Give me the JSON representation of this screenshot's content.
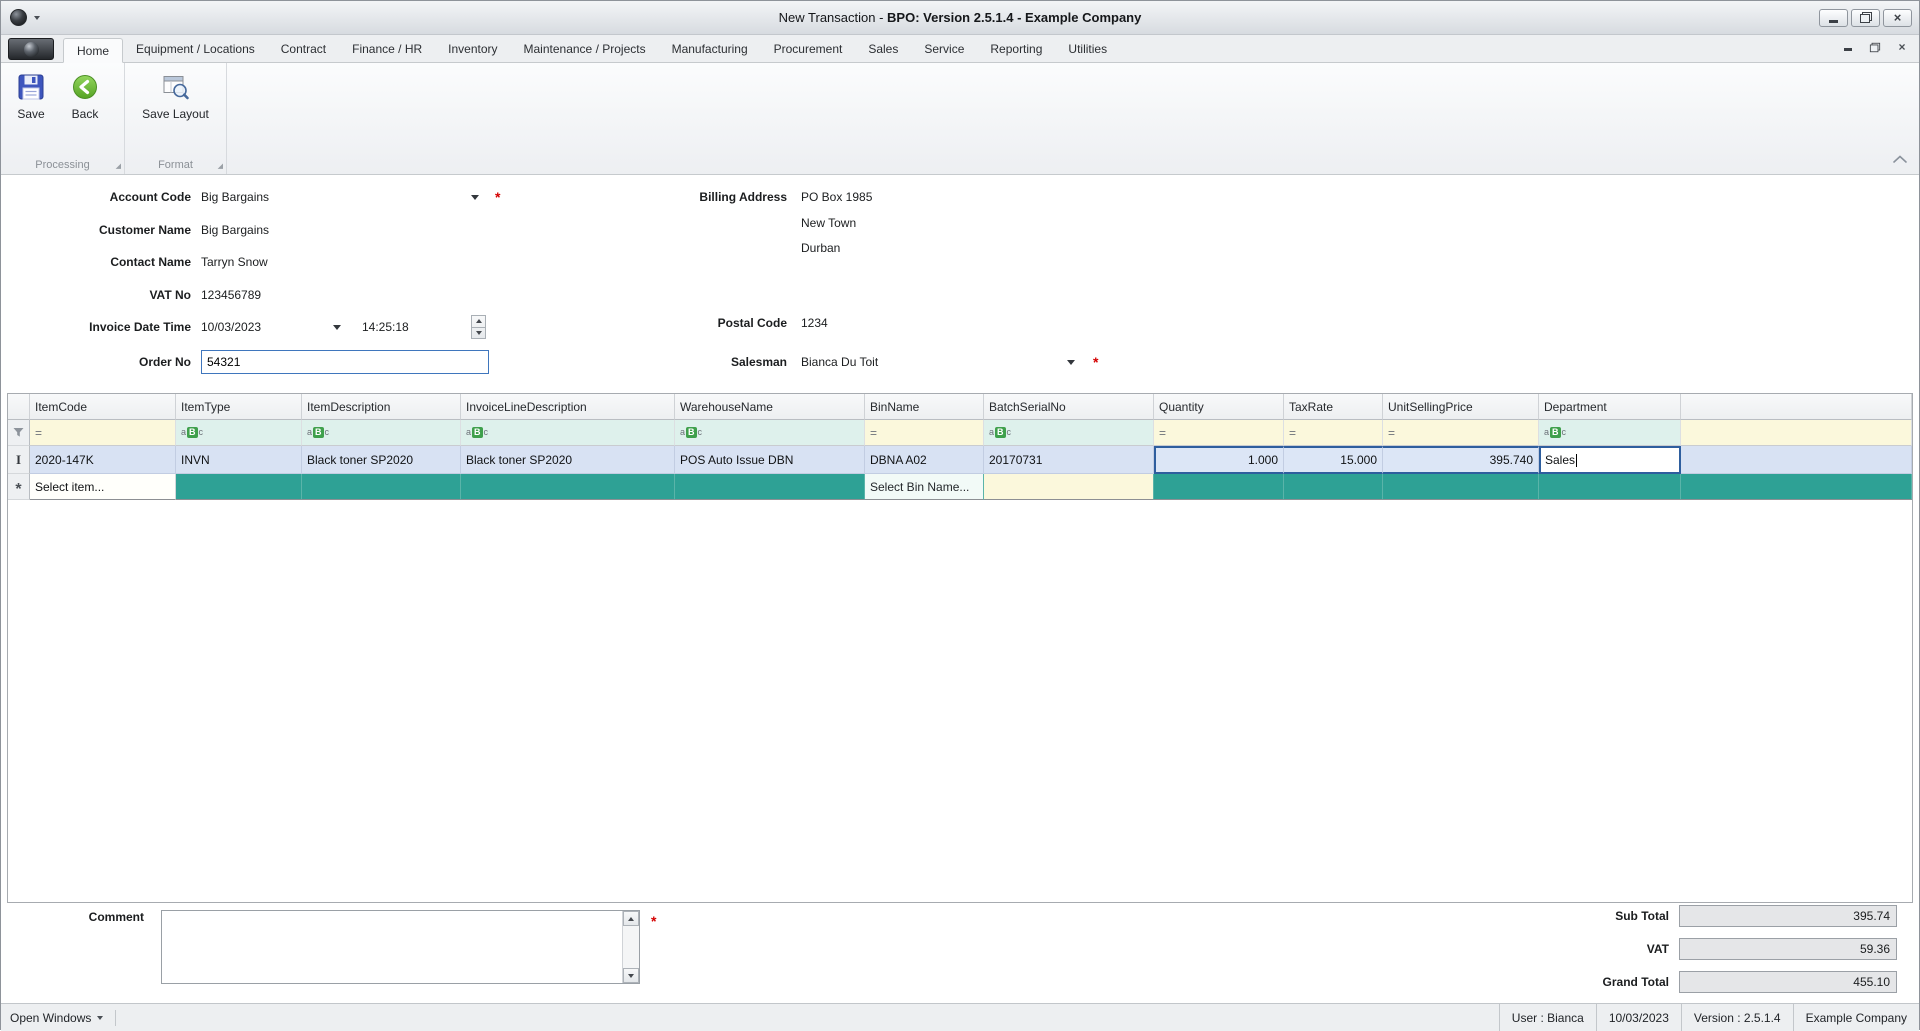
{
  "window": {
    "title_prefix": "New Transaction - ",
    "title_main": "BPO: Version 2.5.1.4 - Example Company"
  },
  "icons": {
    "close": "×",
    "dialog_launcher": "◢"
  },
  "ribbon": {
    "tabs": [
      "Home",
      "Equipment / Locations",
      "Contract",
      "Finance / HR",
      "Inventory",
      "Maintenance / Projects",
      "Manufacturing",
      "Procurement",
      "Sales",
      "Service",
      "Reporting",
      "Utilities"
    ],
    "buttons": {
      "save": "Save",
      "back": "Back",
      "save_layout": "Save Layout"
    },
    "groups": {
      "processing": "Processing",
      "format": "Format"
    }
  },
  "form": {
    "required_marker": "*",
    "account_code": {
      "label": "Account Code",
      "value": "Big Bargains"
    },
    "customer_name": {
      "label": "Customer Name",
      "value": "Big Bargains"
    },
    "contact_name": {
      "label": "Contact Name",
      "value": "Tarryn Snow"
    },
    "vat_no": {
      "label": "VAT No",
      "value": "123456789"
    },
    "invoice_date_time": {
      "label": "Invoice Date Time",
      "date": "10/03/2023",
      "time": "14:25:18"
    },
    "order_no": {
      "label": "Order No",
      "value": "54321"
    },
    "billing_address": {
      "label": "Billing Address",
      "line1": "PO Box 1985",
      "line2": "New Town",
      "line3": "Durban"
    },
    "postal_code": {
      "label": "Postal Code",
      "value": "1234"
    },
    "salesman": {
      "label": "Salesman",
      "value": "Bianca Du Toit"
    }
  },
  "grid": {
    "columns": [
      "ItemCode",
      "ItemType",
      "ItemDescription",
      "InvoiceLineDescription",
      "WarehouseName",
      "BinName",
      "BatchSerialNo",
      "Quantity",
      "TaxRate",
      "UnitSellingPrice",
      "Department"
    ],
    "filter_operators": {
      "equals": "=",
      "abc_a": "a",
      "abc_b": "B",
      "abc_c": "c"
    },
    "indicators": {
      "edit": "I",
      "new": "*"
    },
    "row": {
      "item_code": "2020-147K",
      "item_type": "INVN",
      "item_description": "Black toner SP2020",
      "invoice_line_description": "Black toner SP2020",
      "warehouse_name": "POS Auto Issue DBN",
      "bin_name": "DBNA A02",
      "batch_serial_no": "20170731",
      "quantity": "1.000",
      "tax_rate": "15.000",
      "unit_selling_price": "395.740",
      "department": "Sales"
    },
    "new_row": {
      "item_placeholder": "Select item...",
      "bin_placeholder": "Select Bin Name..."
    }
  },
  "footer": {
    "comment_label": "Comment",
    "totals": {
      "sub_total": {
        "label": "Sub Total",
        "value": "395.74"
      },
      "vat": {
        "label": "VAT",
        "value": "59.36"
      },
      "grand_total": {
        "label": "Grand Total",
        "value": "455.10"
      }
    }
  },
  "statusbar": {
    "open_windows": "Open Windows",
    "user": "User : Bianca",
    "date": "10/03/2023",
    "version": "Version : 2.5.1.4",
    "company": "Example Company"
  }
}
